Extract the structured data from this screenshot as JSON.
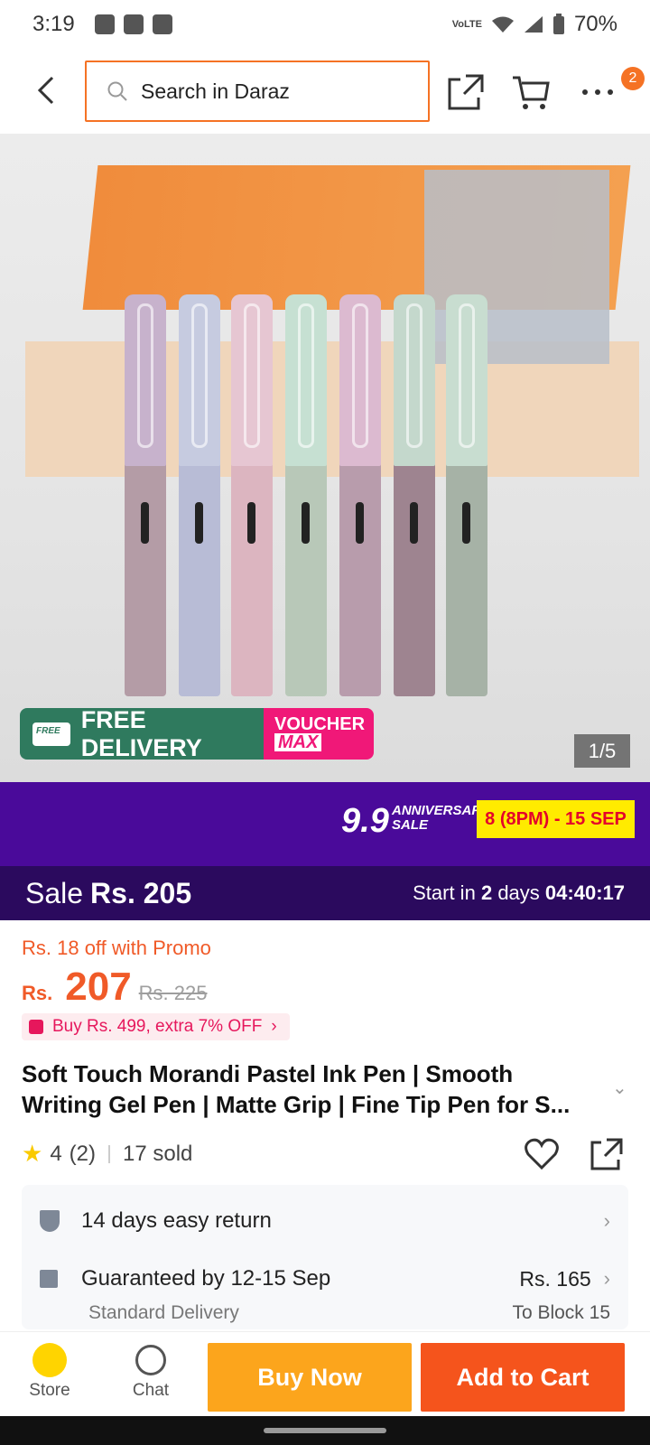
{
  "status_bar": {
    "time": "3:19",
    "battery": "70%",
    "network": "VoLTE"
  },
  "header": {
    "search_placeholder": "Search in Daraz",
    "badge_count": "2"
  },
  "hero": {
    "pager": "1/5",
    "free_delivery": "FREE DELIVERY",
    "free_tag": "FREE",
    "voucher_line1": "VOUCHER",
    "voucher_line2": "MAX"
  },
  "campaign": {
    "num": "9.9",
    "line1": "ANNIVERSARY",
    "line2": "SALE",
    "dates": "8 (8PM) - 15 SEP"
  },
  "sale": {
    "label": "Sale",
    "price": "Rs. 205",
    "start_prefix": "Start in",
    "days": "2",
    "days_label": "days",
    "countdown": "04:40:17"
  },
  "price": {
    "promo": "Rs. 18 off with Promo",
    "currency": "Rs.",
    "value": "207",
    "old": "Rs. 225",
    "extra_offer": "Buy Rs. 499, extra 7% OFF"
  },
  "product": {
    "title": "Soft Touch Morandi Pastel Ink Pen | Smooth Writing Gel Pen | Matte Grip | Fine Tip Pen for S...",
    "rating": "4",
    "reviews": "(2)",
    "sold": "17 sold"
  },
  "info": {
    "return_policy": "14 days easy return",
    "delivery": "Guaranteed by 12-15 Sep",
    "delivery_type": "Standard Delivery",
    "delivery_price": "Rs. 165",
    "destination": "To Block 15"
  },
  "bottom": {
    "store": "Store",
    "chat": "Chat",
    "buy_now": "Buy Now",
    "add_to_cart": "Add to Cart"
  },
  "colors": {
    "accent": "#f57224",
    "campaign_bg": "#4a0a9a",
    "sale_bg": "#2b0a5e",
    "buy": "#fca51c",
    "cart": "#f5541c"
  }
}
